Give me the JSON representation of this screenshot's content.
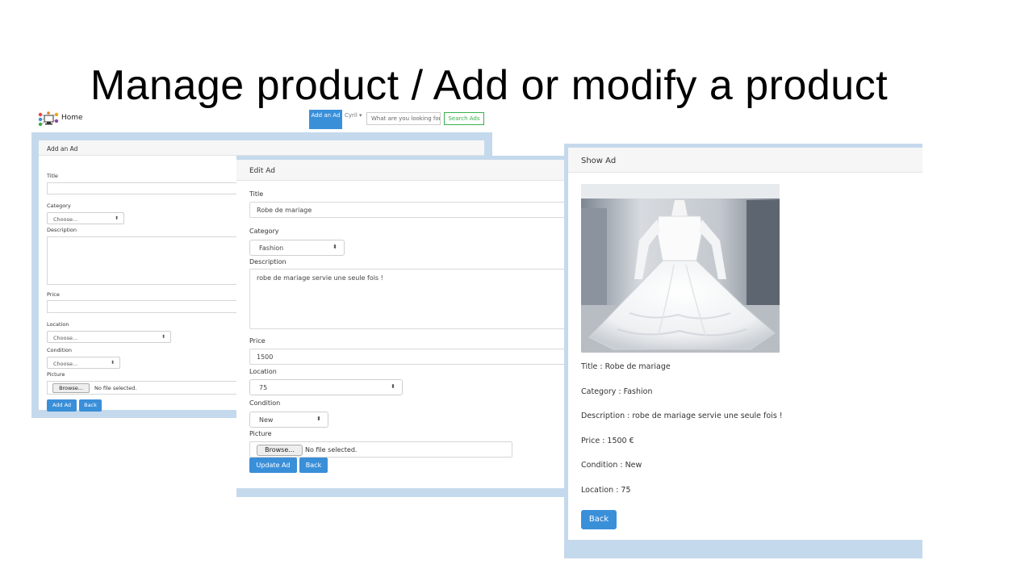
{
  "slide_title": "Manage product / Add or modify a product",
  "navbar": {
    "brand": "Home",
    "add_ad_label": "Add an Ad",
    "user": "Cyril ▾",
    "search_placeholder": "What are you looking for",
    "search_button": "Search Ads"
  },
  "add_form": {
    "header": "Add an Ad",
    "title_label": "Title",
    "category_label": "Category",
    "category_value": "Choose...",
    "description_label": "Description",
    "price_label": "Price",
    "location_label": "Location",
    "location_value": "Choose...",
    "condition_label": "Condition",
    "condition_value": "Choose...",
    "picture_label": "Picture",
    "browse_label": "Browse...",
    "no_file": "No file selected.",
    "submit_label": "Add Ad",
    "back_label": "Back"
  },
  "edit_form": {
    "header": "Edit Ad",
    "title_label": "Title",
    "title_value": "Robe de mariage",
    "category_label": "Category",
    "category_value": "Fashion",
    "description_label": "Description",
    "description_value": "robe de mariage servie une seule fois !",
    "price_label": "Price",
    "price_value": "1500",
    "location_label": "Location",
    "location_value": "75",
    "condition_label": "Condition",
    "condition_value": "New",
    "picture_label": "Picture",
    "browse_label": "Browse...",
    "no_file": "No file selected.",
    "submit_label": "Update Ad",
    "back_label": "Back"
  },
  "show_ad": {
    "header": "Show Ad",
    "title_line": "Title : Robe de mariage",
    "category_line": "Category : Fashion",
    "description_line": "Description : robe de mariage servie une seule fois !",
    "price_line": "Price : 1500 €",
    "condition_line": "Condition : New",
    "location_line": "Location : 75",
    "back_label": "Back"
  },
  "icons": {
    "brand": "network-computer-icon",
    "select_arrow": "updown-arrow-icon",
    "photo": "wedding-dress-photo"
  },
  "colors": {
    "primary": "#3a8fd9",
    "success": "#37b24d",
    "frame": "#c5d9ec"
  }
}
